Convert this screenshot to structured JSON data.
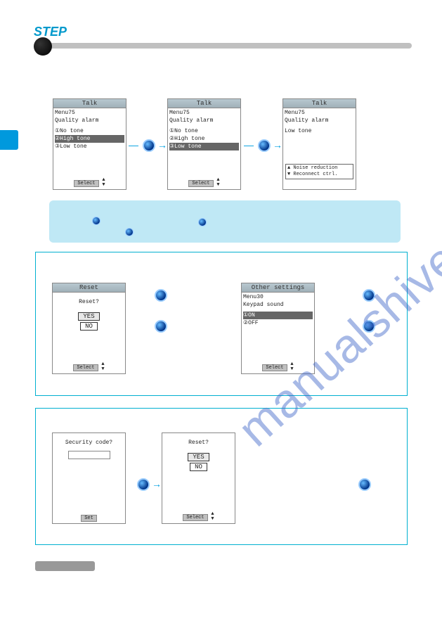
{
  "header": {
    "step_label": "STEP"
  },
  "watermark": "manualshive.com",
  "phones": {
    "talk1": {
      "title": "Talk",
      "menu": "Menu75",
      "subtitle": "Quality alarm",
      "items": [
        "①No tone",
        "②High tone",
        "③Low tone"
      ],
      "selected_index": 1,
      "soft": "Select"
    },
    "talk2": {
      "title": "Talk",
      "menu": "Menu75",
      "subtitle": "Quality alarm",
      "items": [
        "①No tone",
        "②High tone",
        "③Low tone"
      ],
      "selected_index": 2,
      "soft": "Select"
    },
    "talk3": {
      "title": "Talk",
      "menu": "Menu75",
      "subtitle": "Quality alarm",
      "status": "Low tone",
      "hint1": "▲ Noise reduction",
      "hint2": "▼ Reconnect ctrl."
    },
    "reset1": {
      "title": "Reset",
      "prompt": "Reset?",
      "yes": "YES",
      "no": "NO",
      "soft": "Select"
    },
    "other": {
      "title": "Other settings",
      "menu": "Menu30",
      "subtitle": "Keypad sound",
      "items": [
        "①ON",
        "②OFF"
      ],
      "selected_index": 0,
      "soft": "Select"
    },
    "security": {
      "prompt": "Security code?",
      "soft": "Set"
    },
    "reset2": {
      "title": "",
      "prompt": "Reset?",
      "yes": "YES",
      "no": "NO",
      "soft": "Select"
    }
  }
}
